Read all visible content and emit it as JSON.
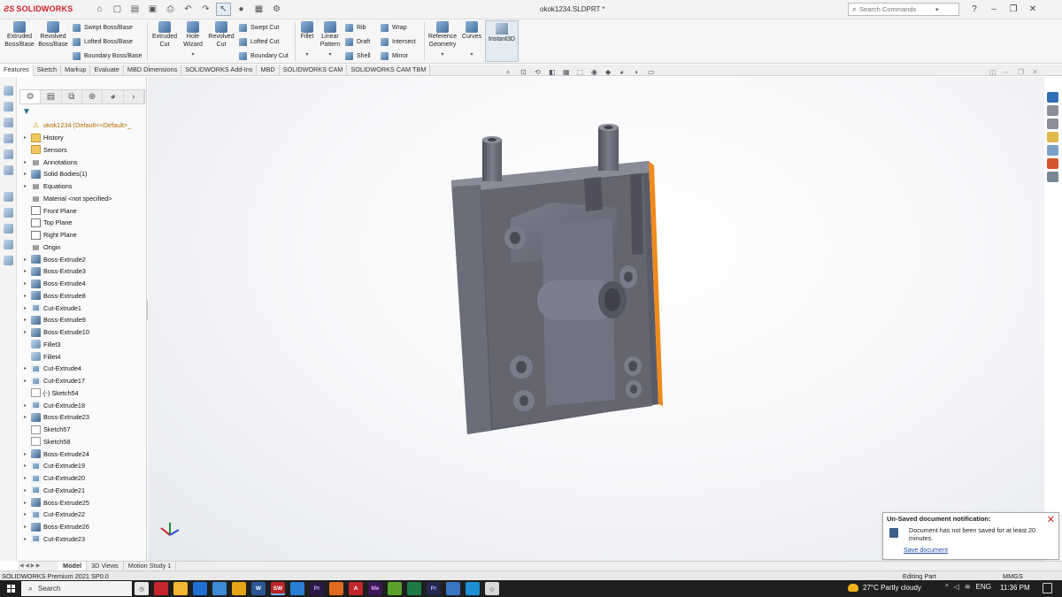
{
  "app": {
    "logo_text": "SOLIDWORKS",
    "doc_title": "okok1234.SLDPRT *",
    "search_placeholder": "Search Commands"
  },
  "ribbon": {
    "extruded_boss": "Extruded Boss/Base",
    "revolved_boss": "Revolved Boss/Base",
    "swept_boss": "Swept Boss/Base",
    "lofted_boss": "Lofted Boss/Base",
    "boundary_boss": "Boundary Boss/Base",
    "extruded_cut": "Extruded Cut",
    "hole_wizard": "Hole Wizard",
    "revolved_cut": "Revolved Cut",
    "swept_cut": "Swept Cut",
    "lofted_cut": "Lofted Cut",
    "boundary_cut": "Boundary Cut",
    "fillet": "Fillet",
    "linear_pattern": "Linear Pattern",
    "rib": "Rib",
    "draft": "Draft",
    "shell": "Shell",
    "wrap": "Wrap",
    "intersect": "Intersect",
    "mirror": "Mirror",
    "reference_geometry": "Reference Geometry",
    "curves": "Curves",
    "instant3d": "Instant3D"
  },
  "command_tabs": [
    "Features",
    "Sketch",
    "Markup",
    "Evaluate",
    "MBD Dimensions",
    "SOLIDWORKS Add-Ins",
    "MBD",
    "SOLIDWORKS CAM",
    "SOLIDWORKS CAM TBM"
  ],
  "tree": {
    "root": "okok1234  (Default<<Default>_",
    "items": [
      {
        "label": "History",
        "icon": "folder",
        "expand": true
      },
      {
        "label": "Sensors",
        "icon": "folder",
        "expand": false
      },
      {
        "label": "Annotations",
        "icon": "text",
        "expand": true
      },
      {
        "label": "Solid Bodies(1)",
        "icon": "boss",
        "expand": true
      },
      {
        "label": "Equations",
        "icon": "text",
        "expand": true
      },
      {
        "label": "Material <not specified>",
        "icon": "text",
        "expand": false
      },
      {
        "label": "Front Plane",
        "icon": "plane",
        "expand": false
      },
      {
        "label": "Top Plane",
        "icon": "plane",
        "expand": false
      },
      {
        "label": "Right Plane",
        "icon": "plane",
        "expand": false
      },
      {
        "label": "Origin",
        "icon": "text",
        "expand": false
      },
      {
        "label": "Boss-Extrude2",
        "icon": "boss",
        "expand": true
      },
      {
        "label": "Boss-Extrude3",
        "icon": "boss",
        "expand": true
      },
      {
        "label": "Boss-Extrude4",
        "icon": "boss",
        "expand": true
      },
      {
        "label": "Boss-Extrude8",
        "icon": "boss",
        "expand": true
      },
      {
        "label": "Cut-Extrude1",
        "icon": "cut",
        "expand": true
      },
      {
        "label": "Boss-Extrude9",
        "icon": "boss",
        "expand": true
      },
      {
        "label": "Boss-Extrude10",
        "icon": "boss",
        "expand": true
      },
      {
        "label": "Fillet3",
        "icon": "fillet",
        "expand": false
      },
      {
        "label": "Fillet4",
        "icon": "fillet",
        "expand": false
      },
      {
        "label": "Cut-Extrude4",
        "icon": "cut",
        "expand": true
      },
      {
        "label": "Cut-Extrude17",
        "icon": "cut",
        "expand": true
      },
      {
        "label": "(-) Sketch54",
        "icon": "sketch",
        "expand": false
      },
      {
        "label": "Cut-Extrude18",
        "icon": "cut",
        "expand": true
      },
      {
        "label": "Boss-Extrude23",
        "icon": "boss",
        "expand": true
      },
      {
        "label": "Sketch57",
        "icon": "sketch",
        "expand": false
      },
      {
        "label": "Sketch58",
        "icon": "sketch",
        "expand": false
      },
      {
        "label": "Boss-Extrude24",
        "icon": "boss",
        "expand": true
      },
      {
        "label": "Cut-Extrude19",
        "icon": "cut",
        "expand": true
      },
      {
        "label": "Cut-Extrude20",
        "icon": "cut",
        "expand": true
      },
      {
        "label": "Cut-Extrude21",
        "icon": "cut",
        "expand": true
      },
      {
        "label": "Boss-Extrude25",
        "icon": "boss",
        "expand": true
      },
      {
        "label": "Cut-Extrude22",
        "icon": "cut",
        "expand": true
      },
      {
        "label": "Boss-Extrude26",
        "icon": "boss",
        "expand": true
      },
      {
        "label": "Cut-Extrude23",
        "icon": "cut",
        "expand": true
      }
    ]
  },
  "notification": {
    "title": "Un-Saved document notification:",
    "body": "Document has not been saved for at least 20 minutes.",
    "link": "Save document"
  },
  "model_tabs": [
    "Model",
    "3D Views",
    "Motion Study 1"
  ],
  "status": {
    "product": "SOLIDWORKS Premium 2021 SP0.0",
    "mode": "Editing Part",
    "units": "MMGS"
  },
  "taskbar": {
    "search_label": "Search",
    "weather": "27°C  Partly cloudy",
    "lang": "ENG",
    "time": "11:36 PM"
  },
  "colors": {
    "brand": "#d2232a",
    "part_face": "#6f707f",
    "selected_edge": "#f08a1c"
  }
}
